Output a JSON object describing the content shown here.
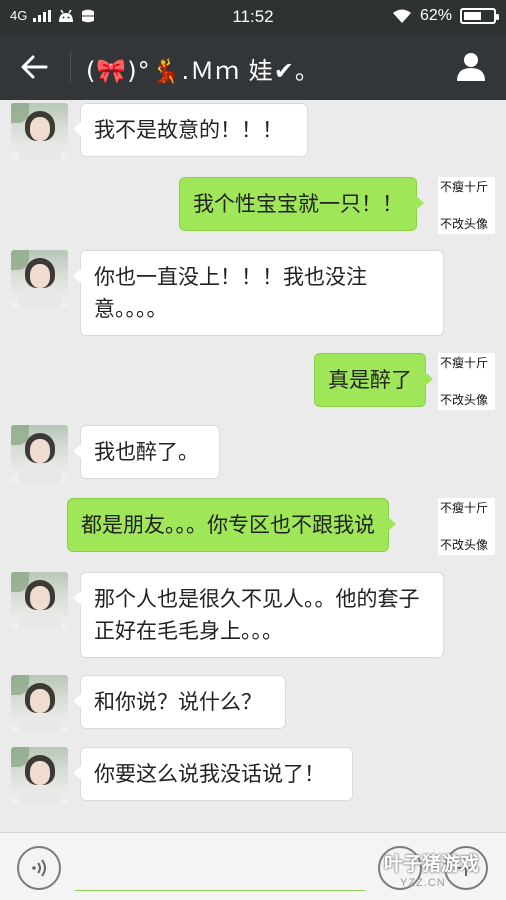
{
  "status_bar": {
    "network": "4G",
    "time": "11:52",
    "battery_text": "62%",
    "battery_level": 0.62
  },
  "header": {
    "title": "(🎀)°💃.Ｍｍ 娃✔。",
    "back_icon": "back-arrow-icon",
    "profile_icon": "person-icon"
  },
  "self_avatar": {
    "line1": "不瘦十斤",
    "line2": "不改头像"
  },
  "messages": [
    {
      "side": "in",
      "text": "我不是故意的！！！"
    },
    {
      "side": "out",
      "text": "我个性宝宝就一只！！"
    },
    {
      "side": "in",
      "text": "你也一直没上！！！我也没注意。。。。"
    },
    {
      "side": "out",
      "text": "真是醉了"
    },
    {
      "side": "in",
      "text": "我也醉了。"
    },
    {
      "side": "out",
      "text": "都是朋友。。。你专区也不跟我说"
    },
    {
      "side": "in",
      "text": "那个人也是很久不见人。。他的套子正好在毛毛身上。。。"
    },
    {
      "side": "in",
      "text": "和你说？说什么？"
    },
    {
      "side": "in",
      "text": "你要这么说我没话说了！"
    }
  ],
  "input_bar": {
    "placeholder": "",
    "watermark": "叶子猪游戏",
    "watermark_sub": "YZZ.CN"
  },
  "colors": {
    "out_bubble": "#9fe658",
    "in_bubble": "#ffffff",
    "header_bg": "#333638",
    "chat_bg": "#ebebeb"
  }
}
